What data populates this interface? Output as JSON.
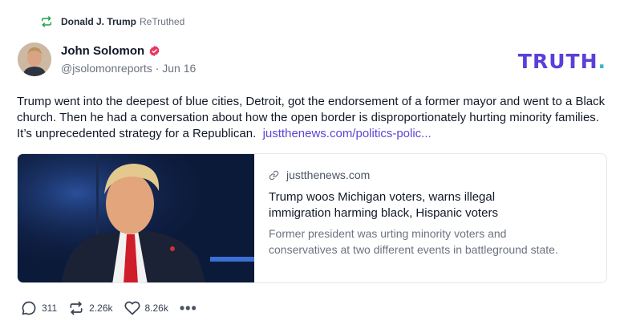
{
  "retruth": {
    "user": "Donald J. Trump",
    "label": "ReTruthed"
  },
  "post": {
    "author_name": "John Solomon",
    "handle": "@jsolomonreports",
    "separator": "·",
    "date": "Jun 16",
    "text": "Trump went into the deepest of blue cities, Detroit, got the endorsement of a former mayor and went to a Black church. Then he had a conversation about how the open border is disproportionately hurting minority families. It’s unprecedented strategy for a Republican.",
    "link_text": "justthenews.com/politics-polic..."
  },
  "logo": {
    "text": "TRUTH",
    "dot": ".",
    "color": "#5b3fd9",
    "dot_color": "#40b4c4"
  },
  "card": {
    "domain": "justthenews.com",
    "title": "Trump woos Michigan voters, warns illegal immigration harming black, Hispanic voters",
    "description": "Former president was urting minority voters and conservatives at two different events in battleground state."
  },
  "actions": {
    "replies": "311",
    "retruths": "2.26k",
    "likes": "8.26k",
    "more": "•••"
  },
  "icons": {
    "retruth": "retruth-icon",
    "verified": "verified-badge-icon",
    "link": "link-icon",
    "reply": "reply-bubble-icon",
    "repost": "retruth-arrows-icon",
    "like": "heart-icon",
    "more": "ellipsis-icon"
  },
  "colors": {
    "accent": "#5b46d4",
    "retruth_green": "#16a34a",
    "verified": "#e8365d"
  }
}
